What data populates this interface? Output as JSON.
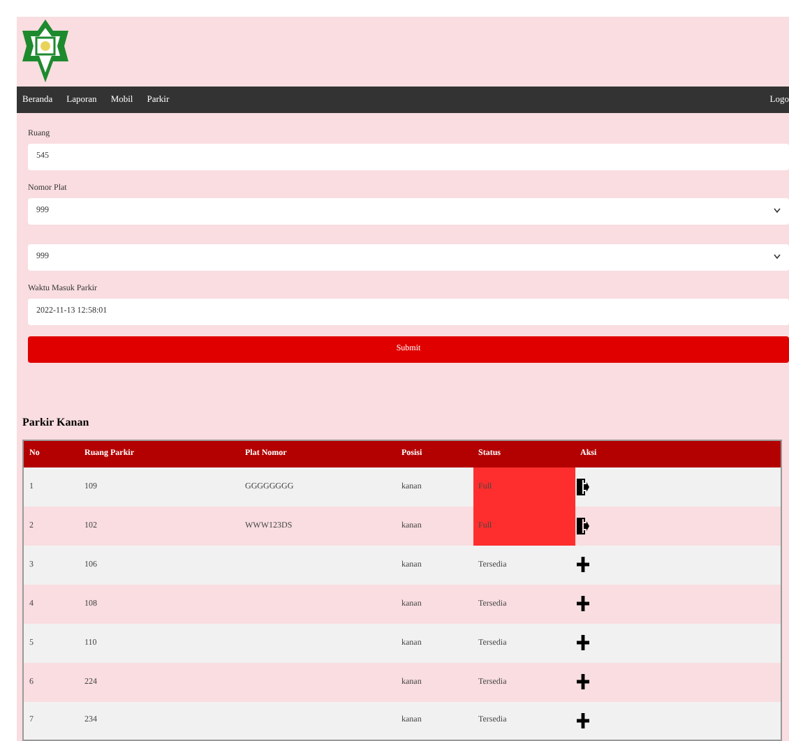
{
  "nav": {
    "items": [
      {
        "label": "Beranda"
      },
      {
        "label": "Laporan"
      },
      {
        "label": "Mobil"
      },
      {
        "label": "Parkir"
      }
    ],
    "right": "Logo"
  },
  "form": {
    "fields": [
      {
        "kind": "input",
        "label": "Ruang",
        "value": "545"
      },
      {
        "kind": "select",
        "label": "Nomor Plat",
        "value": "999"
      },
      {
        "kind": "select",
        "value": "999"
      },
      {
        "kind": "input",
        "label": "Waktu Masuk Parkir",
        "value": "2022-11-13 12:58:01"
      }
    ],
    "submit": "Submit"
  },
  "table": {
    "title": "Parkir Kanan",
    "columns": [
      "No",
      "Ruang Parkir",
      "Plat Nomor",
      "Posisi",
      "Status",
      "Aksi"
    ],
    "rows": [
      {
        "no": "1",
        "ruang": "109",
        "plat": "GGGGGGGG",
        "posisi": "kanan",
        "status": "Full",
        "kind": "full"
      },
      {
        "no": "2",
        "ruang": "102",
        "plat": "WWW123DS",
        "posisi": "kanan",
        "status": "Full",
        "kind": "full"
      },
      {
        "no": "3",
        "ruang": "106",
        "posisi": "kanan",
        "status": "Tersedia",
        "kind": "free"
      },
      {
        "no": "4",
        "ruang": "108",
        "posisi": "kanan",
        "status": "Tersedia",
        "kind": "free"
      },
      {
        "no": "5",
        "ruang": "110",
        "posisi": "kanan",
        "status": "Tersedia",
        "kind": "free"
      },
      {
        "no": "6",
        "ruang": "224",
        "posisi": "kanan",
        "status": "Tersedia",
        "kind": "free"
      },
      {
        "no": "7",
        "ruang": "234",
        "posisi": "kanan",
        "status": "Tersedia",
        "kind": "free"
      }
    ]
  }
}
